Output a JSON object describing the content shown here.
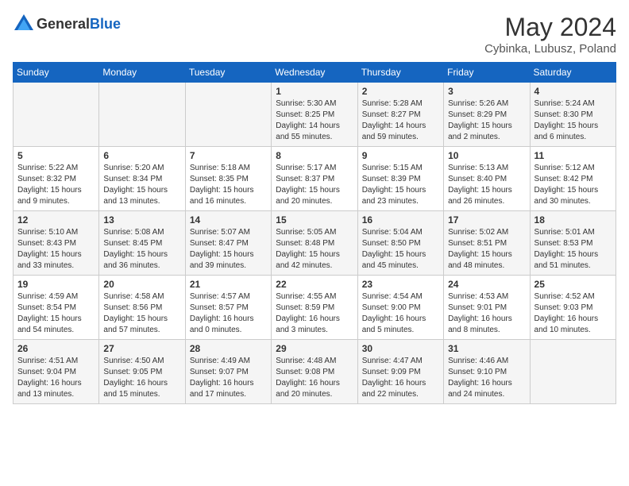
{
  "header": {
    "logo": {
      "text_general": "General",
      "text_blue": "Blue"
    },
    "title": "May 2024",
    "location": "Cybinka, Lubusz, Poland"
  },
  "calendar": {
    "headers": [
      "Sunday",
      "Monday",
      "Tuesday",
      "Wednesday",
      "Thursday",
      "Friday",
      "Saturday"
    ],
    "weeks": [
      [
        {
          "day": "",
          "info": ""
        },
        {
          "day": "",
          "info": ""
        },
        {
          "day": "",
          "info": ""
        },
        {
          "day": "1",
          "info": "Sunrise: 5:30 AM\nSunset: 8:25 PM\nDaylight: 14 hours\nand 55 minutes."
        },
        {
          "day": "2",
          "info": "Sunrise: 5:28 AM\nSunset: 8:27 PM\nDaylight: 14 hours\nand 59 minutes."
        },
        {
          "day": "3",
          "info": "Sunrise: 5:26 AM\nSunset: 8:29 PM\nDaylight: 15 hours\nand 2 minutes."
        },
        {
          "day": "4",
          "info": "Sunrise: 5:24 AM\nSunset: 8:30 PM\nDaylight: 15 hours\nand 6 minutes."
        }
      ],
      [
        {
          "day": "5",
          "info": "Sunrise: 5:22 AM\nSunset: 8:32 PM\nDaylight: 15 hours\nand 9 minutes."
        },
        {
          "day": "6",
          "info": "Sunrise: 5:20 AM\nSunset: 8:34 PM\nDaylight: 15 hours\nand 13 minutes."
        },
        {
          "day": "7",
          "info": "Sunrise: 5:18 AM\nSunset: 8:35 PM\nDaylight: 15 hours\nand 16 minutes."
        },
        {
          "day": "8",
          "info": "Sunrise: 5:17 AM\nSunset: 8:37 PM\nDaylight: 15 hours\nand 20 minutes."
        },
        {
          "day": "9",
          "info": "Sunrise: 5:15 AM\nSunset: 8:39 PM\nDaylight: 15 hours\nand 23 minutes."
        },
        {
          "day": "10",
          "info": "Sunrise: 5:13 AM\nSunset: 8:40 PM\nDaylight: 15 hours\nand 26 minutes."
        },
        {
          "day": "11",
          "info": "Sunrise: 5:12 AM\nSunset: 8:42 PM\nDaylight: 15 hours\nand 30 minutes."
        }
      ],
      [
        {
          "day": "12",
          "info": "Sunrise: 5:10 AM\nSunset: 8:43 PM\nDaylight: 15 hours\nand 33 minutes."
        },
        {
          "day": "13",
          "info": "Sunrise: 5:08 AM\nSunset: 8:45 PM\nDaylight: 15 hours\nand 36 minutes."
        },
        {
          "day": "14",
          "info": "Sunrise: 5:07 AM\nSunset: 8:47 PM\nDaylight: 15 hours\nand 39 minutes."
        },
        {
          "day": "15",
          "info": "Sunrise: 5:05 AM\nSunset: 8:48 PM\nDaylight: 15 hours\nand 42 minutes."
        },
        {
          "day": "16",
          "info": "Sunrise: 5:04 AM\nSunset: 8:50 PM\nDaylight: 15 hours\nand 45 minutes."
        },
        {
          "day": "17",
          "info": "Sunrise: 5:02 AM\nSunset: 8:51 PM\nDaylight: 15 hours\nand 48 minutes."
        },
        {
          "day": "18",
          "info": "Sunrise: 5:01 AM\nSunset: 8:53 PM\nDaylight: 15 hours\nand 51 minutes."
        }
      ],
      [
        {
          "day": "19",
          "info": "Sunrise: 4:59 AM\nSunset: 8:54 PM\nDaylight: 15 hours\nand 54 minutes."
        },
        {
          "day": "20",
          "info": "Sunrise: 4:58 AM\nSunset: 8:56 PM\nDaylight: 15 hours\nand 57 minutes."
        },
        {
          "day": "21",
          "info": "Sunrise: 4:57 AM\nSunset: 8:57 PM\nDaylight: 16 hours\nand 0 minutes."
        },
        {
          "day": "22",
          "info": "Sunrise: 4:55 AM\nSunset: 8:59 PM\nDaylight: 16 hours\nand 3 minutes."
        },
        {
          "day": "23",
          "info": "Sunrise: 4:54 AM\nSunset: 9:00 PM\nDaylight: 16 hours\nand 5 minutes."
        },
        {
          "day": "24",
          "info": "Sunrise: 4:53 AM\nSunset: 9:01 PM\nDaylight: 16 hours\nand 8 minutes."
        },
        {
          "day": "25",
          "info": "Sunrise: 4:52 AM\nSunset: 9:03 PM\nDaylight: 16 hours\nand 10 minutes."
        }
      ],
      [
        {
          "day": "26",
          "info": "Sunrise: 4:51 AM\nSunset: 9:04 PM\nDaylight: 16 hours\nand 13 minutes."
        },
        {
          "day": "27",
          "info": "Sunrise: 4:50 AM\nSunset: 9:05 PM\nDaylight: 16 hours\nand 15 minutes."
        },
        {
          "day": "28",
          "info": "Sunrise: 4:49 AM\nSunset: 9:07 PM\nDaylight: 16 hours\nand 17 minutes."
        },
        {
          "day": "29",
          "info": "Sunrise: 4:48 AM\nSunset: 9:08 PM\nDaylight: 16 hours\nand 20 minutes."
        },
        {
          "day": "30",
          "info": "Sunrise: 4:47 AM\nSunset: 9:09 PM\nDaylight: 16 hours\nand 22 minutes."
        },
        {
          "day": "31",
          "info": "Sunrise: 4:46 AM\nSunset: 9:10 PM\nDaylight: 16 hours\nand 24 minutes."
        },
        {
          "day": "",
          "info": ""
        }
      ]
    ]
  }
}
